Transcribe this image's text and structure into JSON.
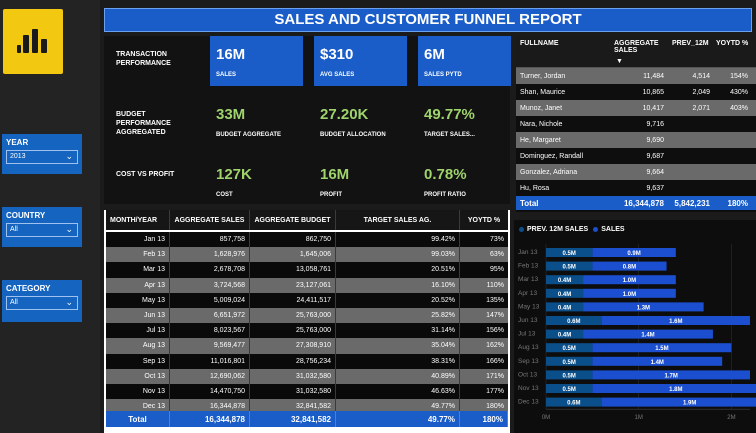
{
  "colors": {
    "accent": "#1a5dc9",
    "kpi_green": "#9fd36c",
    "logo_yellow": "#f2c811",
    "prev_bar": "#0b4f8a",
    "sales_bar": "#1b4fcf"
  },
  "logo": {
    "icon": "power-bi-logo-icon"
  },
  "title": "SALES AND CUSTOMER FUNNEL REPORT",
  "filters": [
    {
      "label": "YEAR",
      "value": "2013"
    },
    {
      "label": "COUNTRY",
      "value": "All"
    },
    {
      "label": "CATEGORY",
      "value": "All"
    }
  ],
  "kpis": {
    "rows": [
      {
        "label": "TRANSACTION PERFORMANCE",
        "cards": [
          {
            "value": "16M",
            "caption": "SALES",
            "style": "blue"
          },
          {
            "value": "$310",
            "caption": "AVG SALES",
            "style": "blue"
          },
          {
            "value": "6M",
            "caption": "SALES PYTD",
            "style": "blue"
          }
        ]
      },
      {
        "label": "BUDGET PERFORMANCE AGGREGATED",
        "cards": [
          {
            "value": "33M",
            "caption": "BUDGET AGGREGATE",
            "style": "green"
          },
          {
            "value": "27.20K",
            "caption": "BUDGET ALLOCATION",
            "style": "green"
          },
          {
            "value": "49.77%",
            "caption": "TARGET SALES...",
            "style": "green"
          }
        ]
      },
      {
        "label": "COST VS PROFIT",
        "cards": [
          {
            "value": "127K",
            "caption": "COST",
            "style": "green"
          },
          {
            "value": "16M",
            "caption": "PROFIT",
            "style": "green"
          },
          {
            "value": "0.78%",
            "caption": "PROFIT RATIO",
            "style": "green"
          }
        ]
      }
    ]
  },
  "customer_table": {
    "headers": [
      "FULLNAME",
      "AGGREGATE SALES",
      "PREV_12M",
      "YOYTD %"
    ],
    "sort_icon": "sort-down-icon",
    "rows": [
      [
        "Turner, Jordan",
        "11,484",
        "4,514",
        "154%"
      ],
      [
        "Shan, Maurice",
        "10,865",
        "2,049",
        "430%"
      ],
      [
        "Munoz, Janet",
        "10,417",
        "2,071",
        "403%"
      ],
      [
        "Nara, Nichole",
        "9,716",
        "",
        ""
      ],
      [
        "He, Margaret",
        "9,690",
        "",
        ""
      ],
      [
        "Dominguez, Randall",
        "9,687",
        "",
        ""
      ],
      [
        "Gonzalez, Adriana",
        "9,664",
        "",
        ""
      ],
      [
        "Hu, Rosa",
        "9,637",
        "",
        ""
      ],
      [
        "Total",
        "16,344,878",
        "5,842,231",
        "180%"
      ]
    ]
  },
  "monthly_table": {
    "headers": [
      "MONTH/YEAR",
      "AGGREGATE SALES",
      "AGGREGATE BUDGET",
      "TARGET SALES AG.",
      "YOYTD %"
    ],
    "rows": [
      [
        "Jan 13",
        "857,758",
        "862,750",
        "99.42%",
        "73%"
      ],
      [
        "Feb 13",
        "1,628,976",
        "1,645,006",
        "99.03%",
        "63%"
      ],
      [
        "Mar 13",
        "2,678,708",
        "13,058,761",
        "20.51%",
        "95%"
      ],
      [
        "Apr 13",
        "3,724,568",
        "23,127,061",
        "16.10%",
        "110%"
      ],
      [
        "May 13",
        "5,009,024",
        "24,411,517",
        "20.52%",
        "135%"
      ],
      [
        "Jun 13",
        "6,651,972",
        "25,763,000",
        "25.82%",
        "147%"
      ],
      [
        "Jul 13",
        "8,023,567",
        "25,763,000",
        "31.14%",
        "156%"
      ],
      [
        "Aug 13",
        "9,569,477",
        "27,308,910",
        "35.04%",
        "162%"
      ],
      [
        "Sep 13",
        "11,016,801",
        "28,756,234",
        "38.31%",
        "166%"
      ],
      [
        "Oct 13",
        "12,690,062",
        "31,032,580",
        "40.89%",
        "171%"
      ],
      [
        "Nov 13",
        "14,470,750",
        "31,032,580",
        "46.63%",
        "177%"
      ],
      [
        "Dec 13",
        "16,344,878",
        "32,841,582",
        "49.77%",
        "180%"
      ]
    ],
    "total": [
      "Total",
      "16,344,878",
      "32,841,582",
      "49.77%",
      "180%"
    ]
  },
  "chart_data": {
    "type": "bar",
    "orientation": "horizontal",
    "stacked": true,
    "legend": [
      "PREV. 12M SALES",
      "SALES"
    ],
    "categories": [
      "Jan 13",
      "Feb 13",
      "Mar 13",
      "Apr 13",
      "May 13",
      "Jun 13",
      "Jul 13",
      "Aug 13",
      "Sep 13",
      "Oct 13",
      "Nov 13",
      "Dec 13"
    ],
    "series": [
      {
        "name": "PREV. 12M SALES",
        "values": [
          0.5,
          0.5,
          0.4,
          0.4,
          0.4,
          0.6,
          0.4,
          0.5,
          0.5,
          0.5,
          0.5,
          0.6
        ],
        "labels": [
          "0.5M",
          "0.5M",
          "0.4M",
          "0.4M",
          "0.4M",
          "0.6M",
          "0.4M",
          "0.5M",
          "0.5M",
          "0.5M",
          "0.5M",
          "0.6M"
        ]
      },
      {
        "name": "SALES",
        "values": [
          0.9,
          0.8,
          1.0,
          1.0,
          1.3,
          1.6,
          1.4,
          1.5,
          1.4,
          1.7,
          1.8,
          1.9
        ],
        "labels": [
          "0.9M",
          "0.8M",
          "1.0M",
          "1.0M",
          "1.3M",
          "1.6M",
          "1.4M",
          "1.5M",
          "1.4M",
          "1.7M",
          "1.8M",
          "1.9M"
        ]
      }
    ],
    "x_ticks": [
      "0M",
      "1M",
      "2M"
    ],
    "xlim": [
      0,
      2.2
    ],
    "unit": "M"
  }
}
